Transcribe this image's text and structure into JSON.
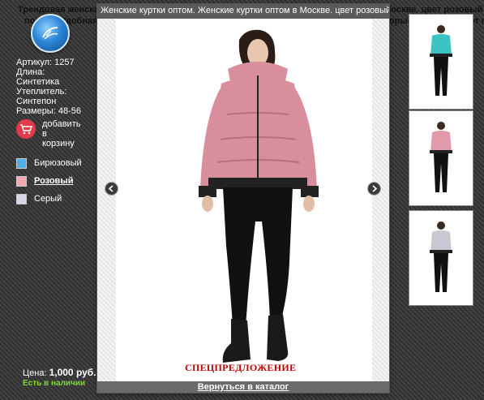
{
  "background": {
    "line1": "Трендовая женская куртка – фото Женские куртки оптом. Женские куртки оптом в Москве. цвет розовый  Модель короткого",
    "line2": "покроя. Удобная женская куртка – это стильная модель для молодых модниц, которые предпочитают носить"
  },
  "product": {
    "article": "Артикул: 1257",
    "length_label": "Длина:",
    "length_value": "Синтетика",
    "insulation_label": "Утеплитель:",
    "insulation_value": "Синтепон",
    "sizes": "Размеры: 48-56"
  },
  "cart": {
    "label_line1": "добавить",
    "label_line2": "в",
    "label_line3": "корзину",
    "icon": "cart-icon"
  },
  "colors": [
    {
      "label": "Бирюзовый",
      "hex": "#4fb0e8",
      "active": false
    },
    {
      "label": "Розовый",
      "hex": "#f2a7b4",
      "active": true
    },
    {
      "label": "Серый",
      "hex": "#d6d6e6",
      "active": false
    }
  ],
  "price": {
    "label": "Цена:",
    "value": "1,000 руб.",
    "stock": "Есть в наличии"
  },
  "modal": {
    "title": "Женские куртки оптом. Женские куртки оптом в Москве. цвет розовый",
    "special": "СПЕЦПРЕДЛОЖЕНИЕ",
    "back_link": "Вернуться в каталог"
  },
  "thumbnails": [
    {
      "jacket_color": "#3cc3c3"
    },
    {
      "jacket_color": "#e39aaa"
    },
    {
      "jacket_color": "#c8c8d2"
    }
  ],
  "accent": {
    "jacket_pink": "#d98e9e",
    "stock_green": "#7fd63a",
    "special_red": "#c00000"
  }
}
